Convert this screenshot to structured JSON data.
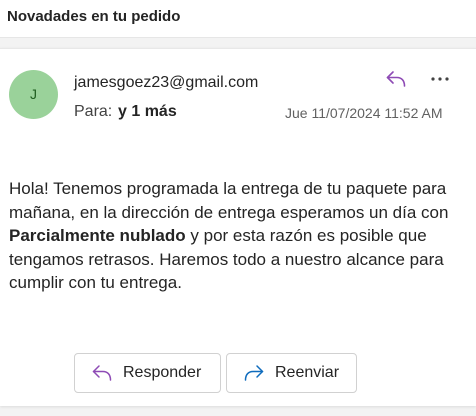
{
  "subject": "Novadades en tu pedido",
  "message": {
    "avatar_initial": "J",
    "sender": "jamesgoez23@gmail.com",
    "to_label": "Para:",
    "to_more": "y 1 más",
    "date": "Jue 11/07/2024 11:52 AM",
    "body": {
      "part1": "Hola! Tenemos programada la entrega de tu paquete para mañana, en la dirección de entrega esperamos un día con ",
      "bold": "Parcialmente nublado",
      "part2": " y por esta razón es posible que tengamos retrasos. Haremos todo a nuestro alcance para cumplir con tu entrega."
    }
  },
  "actions": {
    "reply_label": "Responder",
    "forward_label": "Reenviar"
  },
  "icons": {
    "reply": "reply-arrow-icon",
    "more": "more-horizontal-icon",
    "forward": "forward-arrow-icon"
  },
  "colors": {
    "accent_purple": "#8e4bb5",
    "accent_blue": "#0f6cbd",
    "avatar_bg": "#9ad29a"
  }
}
